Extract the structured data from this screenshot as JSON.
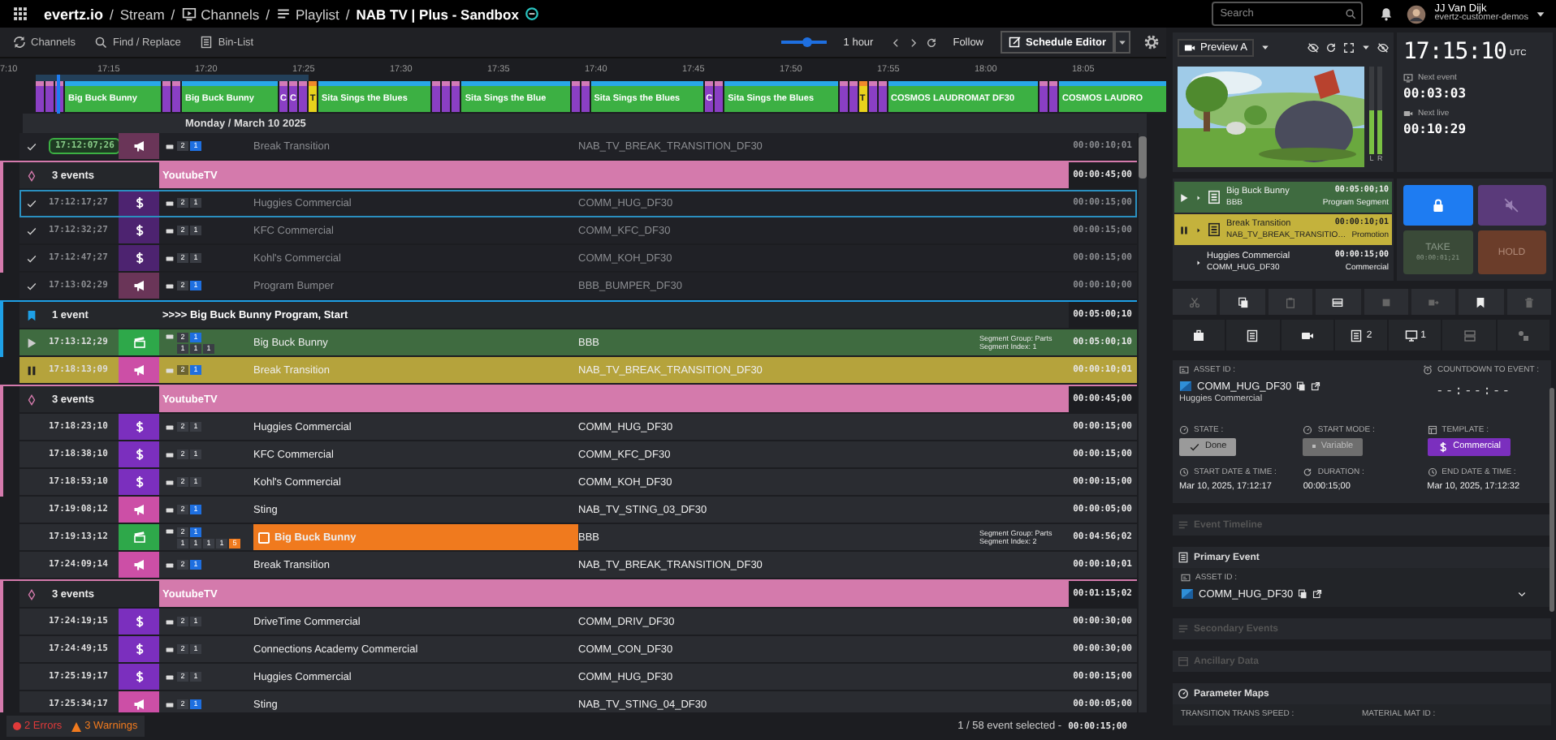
{
  "topbar": {
    "logo": "evertz.io",
    "separator": "/",
    "crumbs": [
      {
        "kind": "text",
        "label": "Stream"
      },
      {
        "kind": "tv",
        "label": "Channels"
      },
      {
        "kind": "list",
        "label": "Playlist"
      },
      {
        "kind": "current",
        "label": "NAB TV | Plus - Sandbox"
      }
    ],
    "search": {
      "placeholder": "Search"
    },
    "user": {
      "name": "JJ Van Dijk",
      "org": "evertz-customer-demos"
    }
  },
  "toolbar": {
    "items": [
      {
        "kind": "sync",
        "label": "Channels"
      },
      {
        "kind": "search",
        "label": "Find / Replace"
      },
      {
        "kind": "doc",
        "label": "Bin-List"
      }
    ],
    "zoom": {
      "level": 0.55,
      "label": "1 hour"
    },
    "follow": "Follow",
    "editor": "Schedule Editor"
  },
  "timeline": {
    "ticks": [
      "7:10",
      "17:15",
      "17:20",
      "17:25",
      "17:30",
      "17:35",
      "17:40",
      "17:45",
      "17:50",
      "17:55",
      "18:00",
      "18:05"
    ],
    "blocks": [
      {
        "kind": "ad"
      },
      {
        "kind": "ad"
      },
      {
        "kind": "ad"
      },
      {
        "kind": "program",
        "label": "Big Buck Bunny"
      },
      {
        "kind": "ad"
      },
      {
        "kind": "ad"
      },
      {
        "kind": "program",
        "label": "Big Buck Bunny"
      },
      {
        "kind": "ad",
        "label": "C"
      },
      {
        "kind": "ad",
        "label": "C"
      },
      {
        "kind": "ad"
      },
      {
        "kind": "promo",
        "label": "T"
      },
      {
        "kind": "program",
        "label": "Sita Sings the Blues"
      },
      {
        "kind": "ad"
      },
      {
        "kind": "ad"
      },
      {
        "kind": "ad"
      },
      {
        "kind": "program",
        "label": "Sita Sings the Blue"
      },
      {
        "kind": "ad"
      },
      {
        "kind": "ad"
      },
      {
        "kind": "program",
        "label": "Sita Sings the Blues"
      },
      {
        "kind": "ad",
        "label": "C"
      },
      {
        "kind": "ad"
      },
      {
        "kind": "program",
        "label": "Sita Sings the Blues"
      },
      {
        "kind": "ad"
      },
      {
        "kind": "ad"
      },
      {
        "kind": "promo",
        "label": "T"
      },
      {
        "kind": "ad"
      },
      {
        "kind": "ad"
      },
      {
        "kind": "program",
        "label": "COSMOS LAUDROMAT DF30"
      },
      {
        "kind": "ad"
      },
      {
        "kind": "ad"
      },
      {
        "kind": "program",
        "label": "COSMOS LAUDRO"
      }
    ]
  },
  "playlist": {
    "date": "Monday / March 10 2025",
    "items": [
      {
        "kind": "promo",
        "done": true,
        "playing": false,
        "paused": false,
        "hard_start": true,
        "selected": false,
        "highlighted": false,
        "time": "17:12:07;26",
        "flags": [
          {
            "text": "2",
            "color": "#3a3d44"
          },
          {
            "text": "1",
            "color": "#1e6fe0"
          }
        ],
        "name": "Break Transition",
        "asset": "NAB_TV_BREAK_TRANSITION_DF30",
        "duration": "00:00:10;01"
      },
      {
        "kind": "ad_break",
        "color": "#d47aac",
        "count": "3 events",
        "title": "YoutubeTV",
        "duration": "00:00:45;00",
        "children": [
          {
            "kind": "commercial",
            "done": true,
            "playing": false,
            "paused": false,
            "hard_start": false,
            "selected": true,
            "highlighted": false,
            "time": "17:12:17;27",
            "flags": [
              {
                "text": "2",
                "color": "#3a3d44"
              },
              {
                "text": "1",
                "color": "#3a3d44"
              }
            ],
            "name": "Huggies Commercial",
            "asset": "COMM_HUG_DF30",
            "duration": "00:00:15;00"
          },
          {
            "kind": "commercial",
            "done": true,
            "playing": false,
            "paused": false,
            "hard_start": false,
            "selected": false,
            "highlighted": false,
            "time": "17:12:32;27",
            "flags": [
              {
                "text": "2",
                "color": "#3a3d44"
              },
              {
                "text": "1",
                "color": "#3a3d44"
              }
            ],
            "name": "KFC Commercial",
            "asset": "COMM_KFC_DF30",
            "duration": "00:00:15;00"
          },
          {
            "kind": "commercial",
            "done": true,
            "playing": false,
            "paused": false,
            "hard_start": false,
            "selected": false,
            "highlighted": false,
            "time": "17:12:47;27",
            "flags": [
              {
                "text": "2",
                "color": "#3a3d44"
              },
              {
                "text": "1",
                "color": "#3a3d44"
              }
            ],
            "name": "Kohl's Commercial",
            "asset": "COMM_KOH_DF30",
            "duration": "00:00:15;00"
          }
        ]
      },
      {
        "kind": "promo",
        "done": true,
        "playing": false,
        "paused": false,
        "hard_start": false,
        "selected": false,
        "highlighted": false,
        "time": "17:13:02;29",
        "flags": [
          {
            "text": "2",
            "color": "#3a3d44"
          },
          {
            "text": "1",
            "color": "#1e6fe0"
          }
        ],
        "name": "Program Bumper",
        "asset": "BBB_BUMPER_DF30",
        "duration": "00:00:10;00"
      },
      {
        "kind": "marker",
        "color": "#1ea0e6",
        "count": "1 event",
        "title": ">>>> Big Buck Bunny Program, Start",
        "duration": "00:05:00;10",
        "children": [
          {
            "kind": "program",
            "done": false,
            "playing": true,
            "paused": false,
            "hard_start": false,
            "selected": false,
            "highlighted": false,
            "time": "17:13:12;29",
            "flags": [
              {
                "text": "2",
                "color": "#3a3d44"
              },
              {
                "text": "1",
                "color": "#1e6fe0"
              }
            ],
            "flags2": [
              {
                "text": "1",
                "color": "#3a3d44"
              },
              {
                "text": "1",
                "color": "#3a3d44"
              },
              {
                "text": "1",
                "color": "#3a3d44"
              }
            ],
            "name": "Big Buck Bunny",
            "asset": "BBB",
            "segment": [
              "Segment Group: Parts",
              "Segment Index: 1"
            ],
            "duration": "00:05:00;10"
          }
        ]
      },
      {
        "kind": "promo",
        "done": false,
        "playing": false,
        "paused": true,
        "hard_start": false,
        "selected": false,
        "highlighted": false,
        "time": "17:18:13;09",
        "flags": [
          {
            "text": "2",
            "color": "#6b6330"
          },
          {
            "text": "1",
            "color": "#1e6fe0"
          }
        ],
        "name": "Break Transition",
        "asset": "NAB_TV_BREAK_TRANSITION_DF30",
        "duration": "00:00:10;01"
      },
      {
        "kind": "ad_break",
        "color": "#d47aac",
        "count": "3 events",
        "title": "YoutubeTV",
        "duration": "00:00:45;00",
        "children": [
          {
            "kind": "commercial",
            "done": false,
            "playing": false,
            "paused": false,
            "hard_start": false,
            "selected": false,
            "highlighted": false,
            "time": "17:18:23;10",
            "flags": [
              {
                "text": "2",
                "color": "#3a3d44"
              },
              {
                "text": "1",
                "color": "#3a3d44"
              }
            ],
            "name": "Huggies Commercial",
            "asset": "COMM_HUG_DF30",
            "duration": "00:00:15;00"
          },
          {
            "kind": "commercial",
            "done": false,
            "playing": false,
            "paused": false,
            "hard_start": false,
            "selected": false,
            "highlighted": false,
            "time": "17:18:38;10",
            "flags": [
              {
                "text": "2",
                "color": "#3a3d44"
              },
              {
                "text": "1",
                "color": "#3a3d44"
              }
            ],
            "name": "KFC Commercial",
            "asset": "COMM_KFC_DF30",
            "duration": "00:00:15;00"
          },
          {
            "kind": "commercial",
            "done": false,
            "playing": false,
            "paused": false,
            "hard_start": false,
            "selected": false,
            "highlighted": false,
            "time": "17:18:53;10",
            "flags": [
              {
                "text": "2",
                "color": "#3a3d44"
              },
              {
                "text": "1",
                "color": "#3a3d44"
              }
            ],
            "name": "Kohl's Commercial",
            "asset": "COMM_KOH_DF30",
            "duration": "00:00:15;00"
          }
        ]
      },
      {
        "kind": "promo",
        "done": false,
        "playing": false,
        "paused": false,
        "hard_start": false,
        "selected": false,
        "highlighted": false,
        "time": "17:19:08;12",
        "flags": [
          {
            "text": "2",
            "color": "#3a3d44"
          },
          {
            "text": "1",
            "color": "#1e6fe0"
          }
        ],
        "name": "Sting",
        "asset": "NAB_TV_STING_03_DF30",
        "duration": "00:00:05;00"
      },
      {
        "kind": "program",
        "done": false,
        "playing": false,
        "paused": false,
        "hard_start": false,
        "selected": false,
        "highlighted": true,
        "time": "17:19:13;12",
        "flags": [
          {
            "text": "2",
            "color": "#3a3d44"
          },
          {
            "text": "1",
            "color": "#1e6fe0"
          }
        ],
        "flags2": [
          {
            "text": "1",
            "color": "#3a3d44"
          },
          {
            "text": "1",
            "color": "#3a3d44"
          },
          {
            "text": "1",
            "color": "#3a3d44"
          },
          {
            "text": "1",
            "color": "#3a3d44"
          },
          {
            "text": "5",
            "color": "#f07a1e"
          }
        ],
        "name": "Big Buck Bunny",
        "asset": "BBB",
        "segment": [
          "Segment Group: Parts",
          "Segment Index: 2"
        ],
        "duration": "00:04:56;02"
      },
      {
        "kind": "promo",
        "done": false,
        "playing": false,
        "paused": false,
        "hard_start": false,
        "selected": false,
        "highlighted": false,
        "time": "17:24:09;14",
        "flags": [
          {
            "text": "2",
            "color": "#3a3d44"
          },
          {
            "text": "1",
            "color": "#1e6fe0"
          }
        ],
        "name": "Break Transition",
        "asset": "NAB_TV_BREAK_TRANSITION_DF30",
        "duration": "00:00:10;01"
      },
      {
        "kind": "ad_break",
        "color": "#d47aac",
        "count": "3 events",
        "title": "YoutubeTV",
        "duration": "00:01:15;02",
        "children": [
          {
            "kind": "commercial",
            "done": false,
            "playing": false,
            "paused": false,
            "hard_start": false,
            "selected": false,
            "highlighted": false,
            "time": "17:24:19;15",
            "flags": [
              {
                "text": "2",
                "color": "#3a3d44"
              },
              {
                "text": "1",
                "color": "#3a3d44"
              }
            ],
            "name": "DriveTime Commercial",
            "asset": "COMM_DRIV_DF30",
            "duration": "00:00:30;00"
          },
          {
            "kind": "commercial",
            "done": false,
            "playing": false,
            "paused": false,
            "hard_start": false,
            "selected": false,
            "highlighted": false,
            "time": "17:24:49;15",
            "flags": [
              {
                "text": "2",
                "color": "#3a3d44"
              },
              {
                "text": "1",
                "color": "#3a3d44"
              }
            ],
            "name": "Connections Academy Commercial",
            "asset": "COMM_CON_DF30",
            "duration": "00:00:30;00"
          },
          {
            "kind": "commercial",
            "done": false,
            "playing": false,
            "paused": false,
            "hard_start": false,
            "selected": false,
            "highlighted": false,
            "time": "17:25:19;17",
            "flags": [
              {
                "text": "2",
                "color": "#3a3d44"
              },
              {
                "text": "1",
                "color": "#3a3d44"
              }
            ],
            "name": "Huggies Commercial",
            "asset": "COMM_HUG_DF30",
            "duration": "00:00:15;00"
          },
          {
            "kind": "promo",
            "done": false,
            "playing": false,
            "paused": false,
            "hard_start": false,
            "selected": false,
            "highlighted": false,
            "time": "17:25:34;17",
            "flags": [
              {
                "text": "2",
                "color": "#3a3d44"
              },
              {
                "text": "1",
                "color": "#1e6fe0"
              }
            ],
            "name": "Sting",
            "asset": "NAB_TV_STING_04_DF30",
            "duration": "00:00:05;00"
          }
        ]
      }
    ]
  },
  "status_bar": {
    "errors": "2 Errors",
    "warnings": "3 Warnings",
    "selection": "1 / 58 event selected -",
    "duration": "00:00:15;00"
  },
  "preview": {
    "source": "Preview A",
    "meters": [
      {
        "label": "L",
        "level": 0.5
      },
      {
        "label": "R",
        "level": 0.5
      }
    ]
  },
  "clock": {
    "time": "17:15:10",
    "zone": "UTC",
    "next": [
      {
        "kind": "event",
        "label": "Next event",
        "time": "00:03:03"
      },
      {
        "kind": "live",
        "label": "Next live",
        "time": "00:10:29"
      }
    ]
  },
  "now_list": [
    {
      "playing": true,
      "paused": false,
      "title": "Big Buck Bunny",
      "duration": "00:05:00;10",
      "asset": "BBB",
      "type": "Program Segment"
    },
    {
      "playing": false,
      "paused": true,
      "title": "Break Transition",
      "duration": "00:00:10;01",
      "asset": "NAB_TV_BREAK_TRANSITIO…",
      "type": "Promotion"
    },
    {
      "playing": false,
      "paused": false,
      "title": "Huggies Commercial",
      "duration": "00:00:15;00",
      "asset": "COMM_HUG_DF30",
      "type": "Commercial"
    }
  ],
  "controls": [
    {
      "kind": "lock"
    },
    {
      "kind": "mute"
    },
    {
      "kind": "take",
      "label": "TAKE",
      "time": "00:00:01;21"
    },
    {
      "kind": "hold",
      "label": "HOLD"
    }
  ],
  "edit_tools": [
    {
      "kind": "cut",
      "disabled": true
    },
    {
      "kind": "copy",
      "disabled": false
    },
    {
      "kind": "paste",
      "disabled": true
    },
    {
      "kind": "clip",
      "disabled": false
    },
    {
      "kind": "stop",
      "disabled": true
    },
    {
      "kind": "move",
      "disabled": true
    },
    {
      "kind": "bookmark",
      "disabled": false
    },
    {
      "kind": "delete",
      "disabled": true
    }
  ],
  "tabs": [
    {
      "kind": "case",
      "disabled": false
    },
    {
      "kind": "list",
      "disabled": false
    },
    {
      "kind": "camera",
      "disabled": false
    },
    {
      "kind": "doc",
      "count": "2",
      "disabled": false
    },
    {
      "kind": "monitor",
      "count": "1",
      "disabled": false
    },
    {
      "kind": "server",
      "disabled": true
    },
    {
      "kind": "shapes",
      "disabled": true
    }
  ],
  "details": {
    "asset_label": "ASSET ID :",
    "asset": "COMM_HUG_DF30",
    "asset_name": "Huggies Commercial",
    "countdown_label": "COUNTDOWN TO EVENT :",
    "countdown": "--:--:--",
    "fields": [
      {
        "kind": "state",
        "label": "STATE :",
        "value": "Done"
      },
      {
        "kind": "mode",
        "label": "START MODE :",
        "value": "Variable"
      },
      {
        "kind": "template",
        "label": "TEMPLATE :",
        "value": "Commercial"
      },
      {
        "kind": "text",
        "label": "START DATE & TIME :",
        "value": "Mar 10, 2025, 17:12:17"
      },
      {
        "kind": "text",
        "label": "DURATION :",
        "value": "00:00:15;00"
      },
      {
        "kind": "text",
        "label": "END DATE & TIME :",
        "value": "Mar 10, 2025, 17:12:32"
      }
    ]
  },
  "sections": [
    {
      "title": "Event Timeline",
      "disabled": true
    },
    {
      "title": "Primary Event",
      "disabled": false,
      "asset_label": "ASSET ID :",
      "asset": "COMM_HUG_DF30"
    },
    {
      "title": "Secondary Events",
      "disabled": true
    },
    {
      "title": "Ancillary Data",
      "disabled": true
    },
    {
      "title": "Parameter Maps",
      "disabled": false,
      "labels": [
        "TRANSITION TRANS SPEED :",
        "MATERIAL MAT ID :"
      ]
    }
  ]
}
